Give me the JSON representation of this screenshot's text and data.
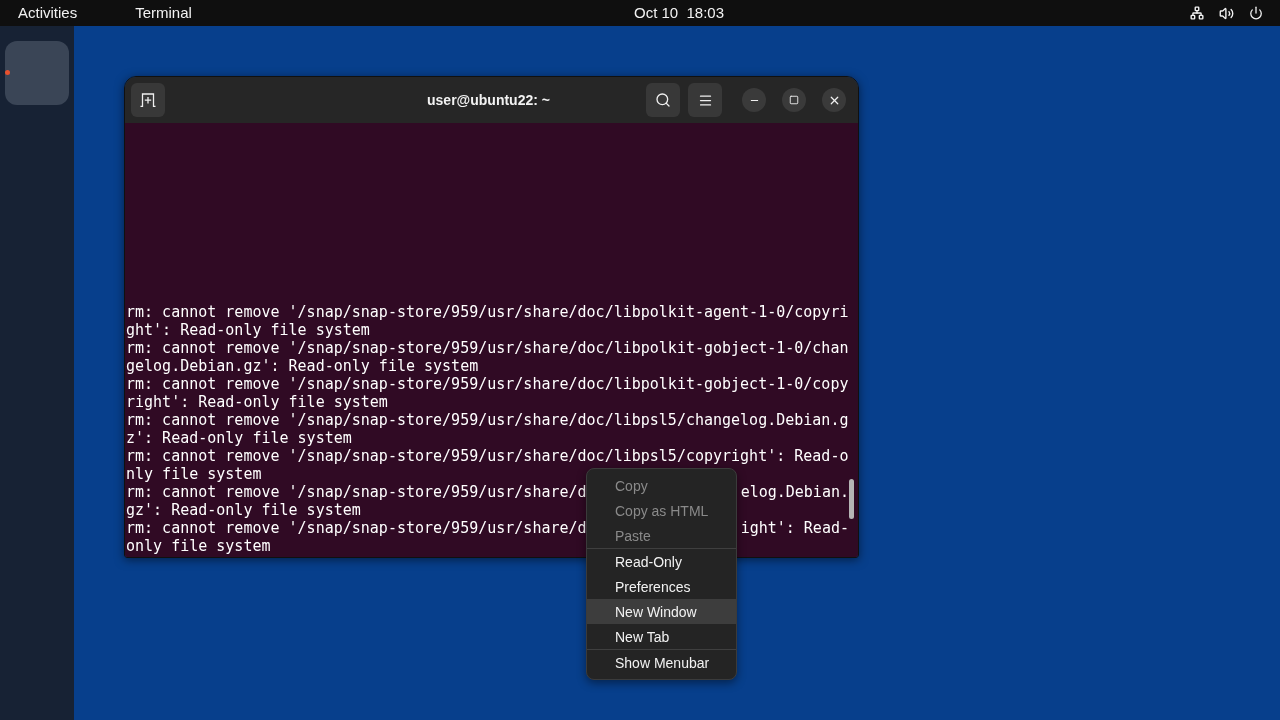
{
  "top_bar": {
    "activities": "Activities",
    "app_name": "Terminal",
    "clock": "Oct 10  18:03"
  },
  "dock": {
    "items": [
      {
        "running": true
      }
    ]
  },
  "terminal": {
    "title": "user@ubuntu22: ~",
    "lines": [
      {
        "segments": [
          "rm: cannot remove '/snap/snap-store/959/usr/share/doc/libpolkit-agent-1-0/copyri"
        ]
      },
      {
        "segments": [
          "ght': Read-only file system"
        ]
      },
      {
        "segments": [
          "rm: cannot remove '/snap/snap-store/959/usr/share/doc/libpolkit-gobject-1-0/chan"
        ]
      },
      {
        "segments": [
          "gelog.Debian.gz': Read-only file system"
        ]
      },
      {
        "segments": [
          "rm: cannot remove '/snap/snap-store/959/usr/share/doc/libpolkit-gobject-1-0/copy"
        ]
      },
      {
        "segments": [
          "right': Read-only file system"
        ]
      },
      {
        "segments": [
          "rm: cannot remove '/snap/snap-store/959/usr/share/doc/libpsl5/changelog.Debian.g"
        ]
      },
      {
        "segments": [
          "z': Read-only file system"
        ]
      },
      {
        "segments": [
          "rm: cannot remove '/snap/snap-store/959/usr/share/doc/libpsl5/copyright': Read-o"
        ]
      },
      {
        "segments": [
          "nly file system"
        ]
      },
      {
        "segments": [
          "rm: cannot remove '/snap/snap-store/959/usr/share/d",
          "elog.Debian."
        ]
      },
      {
        "segments": [
          "gz': Read-only file system"
        ]
      },
      {
        "segments": [
          "rm: cannot remove '/snap/snap-store/959/usr/share/d",
          "ight': Read-"
        ]
      },
      {
        "segments": [
          "only file system"
        ]
      }
    ]
  },
  "context_menu": {
    "sections": [
      {
        "items": [
          {
            "label": "Copy",
            "disabled": true,
            "selected": false
          },
          {
            "label": "Copy as HTML",
            "disabled": true,
            "selected": false
          },
          {
            "label": "Paste",
            "disabled": true,
            "selected": false
          }
        ]
      },
      {
        "items": [
          {
            "label": "Read-Only",
            "disabled": false,
            "selected": false
          },
          {
            "label": "Preferences",
            "disabled": false,
            "selected": false
          },
          {
            "label": "New Window",
            "disabled": false,
            "selected": true
          },
          {
            "label": "New Tab",
            "disabled": false,
            "selected": false
          }
        ]
      },
      {
        "items": [
          {
            "label": "Show Menubar",
            "disabled": false,
            "selected": false
          }
        ]
      }
    ]
  }
}
